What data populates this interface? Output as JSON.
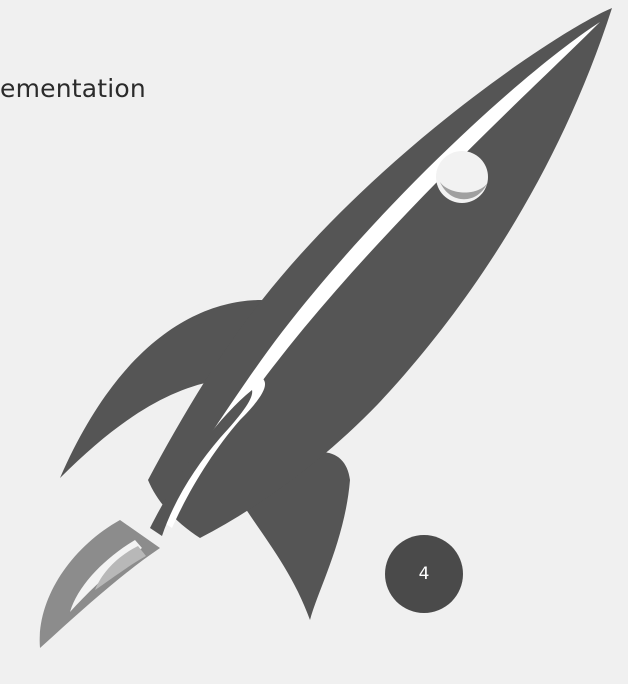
{
  "slide": {
    "title": "ementation",
    "page_number": "4"
  },
  "illustration": {
    "icon": "rocket-icon",
    "body_color": "#555555",
    "highlight_color": "#ffffff",
    "flame_color": "#8a8a8a",
    "background_color": "#f0f0f0"
  }
}
